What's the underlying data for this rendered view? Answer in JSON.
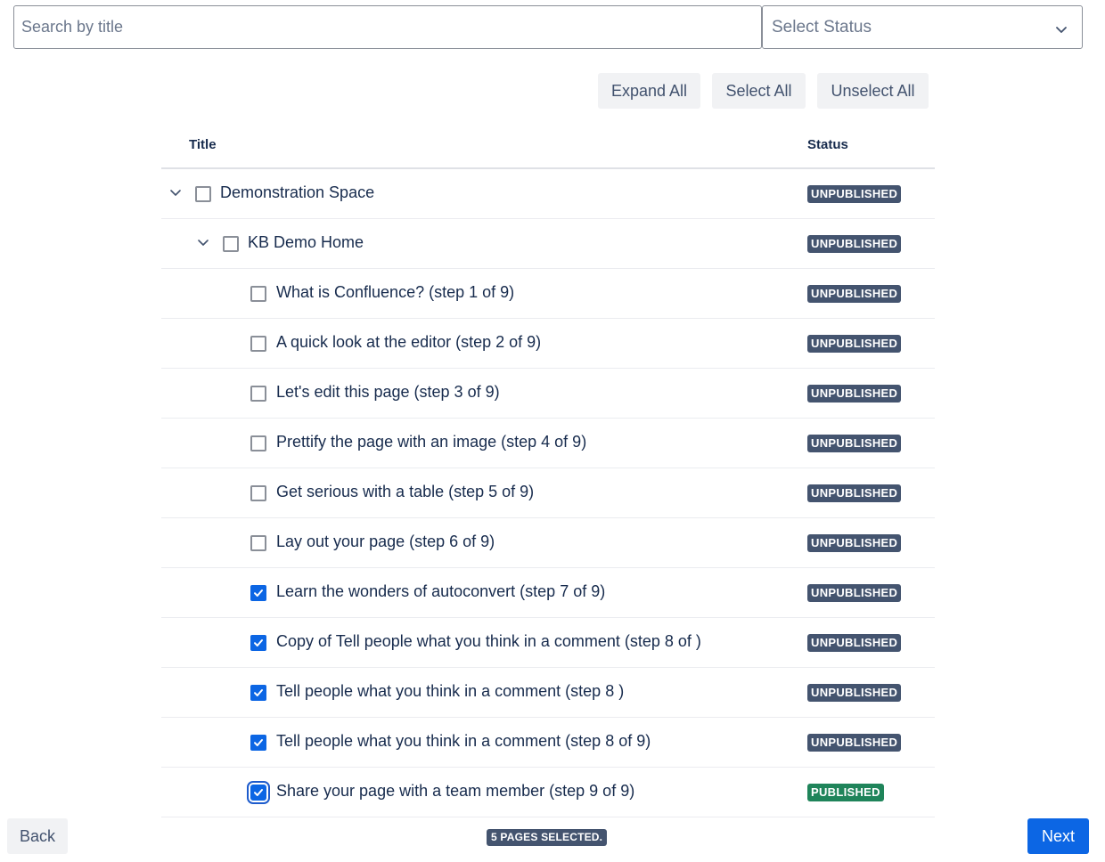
{
  "search": {
    "placeholder": "Search by title",
    "value": ""
  },
  "status_filter": {
    "placeholder": "Select Status"
  },
  "toolbar": {
    "expand_all_label": "Expand All",
    "select_all_label": "Select All",
    "unselect_all_label": "Unselect All"
  },
  "table": {
    "headers": {
      "title": "Title",
      "status": "Status"
    },
    "rows": [
      {
        "title": "Demonstration Space",
        "status": "UNPUBLISHED",
        "level": 0,
        "expandable": true,
        "checked": false
      },
      {
        "title": "KB Demo Home",
        "status": "UNPUBLISHED",
        "level": 1,
        "expandable": true,
        "checked": false
      },
      {
        "title": "What is Confluence? (step 1 of 9)",
        "status": "UNPUBLISHED",
        "level": 2,
        "expandable": false,
        "checked": false
      },
      {
        "title": "A quick look at the editor (step 2 of 9)",
        "status": "UNPUBLISHED",
        "level": 2,
        "expandable": false,
        "checked": false
      },
      {
        "title": "Let's edit this page (step 3 of 9)",
        "status": "UNPUBLISHED",
        "level": 2,
        "expandable": false,
        "checked": false
      },
      {
        "title": "Prettify the page with an image (step 4 of 9)",
        "status": "UNPUBLISHED",
        "level": 2,
        "expandable": false,
        "checked": false
      },
      {
        "title": "Get serious with a table (step 5 of 9)",
        "status": "UNPUBLISHED",
        "level": 2,
        "expandable": false,
        "checked": false
      },
      {
        "title": "Lay out your page (step 6 of 9)",
        "status": "UNPUBLISHED",
        "level": 2,
        "expandable": false,
        "checked": false
      },
      {
        "title": "Learn the wonders of autoconvert (step 7 of 9)",
        "status": "UNPUBLISHED",
        "level": 2,
        "expandable": false,
        "checked": true
      },
      {
        "title": "Copy of Tell people what you think in a comment (step 8 of )",
        "status": "UNPUBLISHED",
        "level": 2,
        "expandable": false,
        "checked": true
      },
      {
        "title": "Tell people what you think in a comment (step 8 )",
        "status": "UNPUBLISHED",
        "level": 2,
        "expandable": false,
        "checked": true
      },
      {
        "title": "Tell people what you think in a comment (step 8 of 9)",
        "status": "UNPUBLISHED",
        "level": 2,
        "expandable": false,
        "checked": true
      },
      {
        "title": "Share your page with a team member (step 9 of 9)",
        "status": "PUBLISHED",
        "level": 2,
        "expandable": false,
        "checked": true,
        "focused": true
      }
    ]
  },
  "footer": {
    "back_label": "Back",
    "next_label": "Next",
    "selected_count_text": "5 PAGES SELECTED."
  },
  "colors": {
    "primary": "#0c66e4",
    "unpublished_lozenge": "#44546f",
    "published_lozenge": "#1f845a"
  },
  "icons": {
    "expand": "chevron-down-icon",
    "select": "chevron-down-icon",
    "check": "checkmark-icon"
  }
}
